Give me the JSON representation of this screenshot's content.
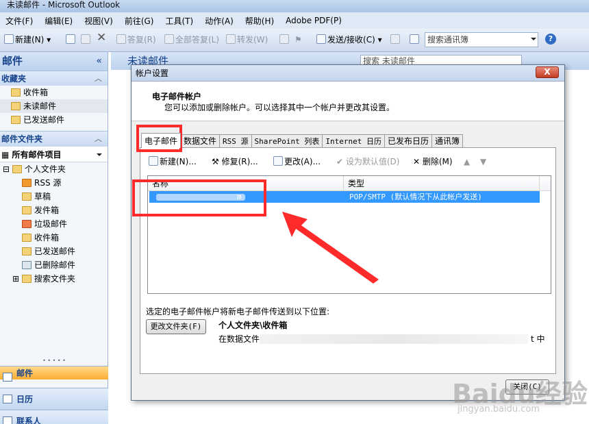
{
  "window": {
    "title": "未读邮件 - Microsoft Outlook"
  },
  "menubar": [
    "文件(F)",
    "编辑(E)",
    "视图(V)",
    "前往(G)",
    "工具(T)",
    "动作(A)",
    "帮助(H)",
    "Adobe PDF(P)"
  ],
  "toolbar": {
    "new_label": "新建(N)",
    "reply_label": "答复(R)",
    "reply_all_label": "全部答复(L)",
    "forward_label": "转发(W)",
    "send_receive_label": "发送/接收(C)",
    "address_search_placeholder": "搜索通讯簿",
    "help_glyph": "?"
  },
  "nav": {
    "header": "邮件",
    "collapse_glyph": "«",
    "favorites_title": "收藏夹",
    "favorites": [
      "收件箱",
      "未读邮件",
      "已发送邮件"
    ],
    "mail_folders_title": "邮件文件夹",
    "all_items": "所有邮件项目",
    "personal_folders": "个人文件夹",
    "folders": [
      "RSS 源",
      "草稿",
      "发件箱",
      "垃圾邮件",
      "收件箱",
      "已发送邮件",
      "已删除邮件"
    ],
    "search_folders": "搜索文件夹",
    "buttons": {
      "mail": "邮件",
      "calendar": "日历",
      "contacts": "联系人"
    }
  },
  "main": {
    "header": "未读邮件",
    "search_placeholder": "搜索 未读邮件"
  },
  "dialog": {
    "title": "帐户设置",
    "close_glyph": "X",
    "heading": "电子邮件帐户",
    "subheading": "您可以添加或删除帐户。可以选择其中一个帐户并更改其设置。",
    "tabs": [
      "电子邮件",
      "数据文件",
      "RSS 源",
      "SharePoint 列表",
      "Internet 日历",
      "已发布日历",
      "通讯簿"
    ],
    "actions": {
      "new": "新建(N)...",
      "repair": "修复(R)...",
      "change": "更改(A)...",
      "set_default": "设为默认值(D)",
      "remove": "删除(M)"
    },
    "list": {
      "col_name": "名称",
      "col_type": "类型",
      "row_name_tail": "m",
      "row_type": "POP/SMTP (默认情况下从此帐户发送)"
    },
    "deliver_label": "选定的电子邮件帐户将新电子邮件传送到以下位置:",
    "change_folder_btn": "更改文件夹(F)",
    "deliver_folder": "个人文件夹\\收件箱",
    "deliver_file_prefix": "在数据文件",
    "deliver_file_suffix": "t 中",
    "close_btn": "关闭(C)"
  },
  "watermark": {
    "brand": "Baidu经验",
    "url": "jingyan.baidu.com"
  },
  "colors": {
    "selection": "#3399ff",
    "annotation_red": "#ff2a2a",
    "nav_active": "#ffad33"
  }
}
